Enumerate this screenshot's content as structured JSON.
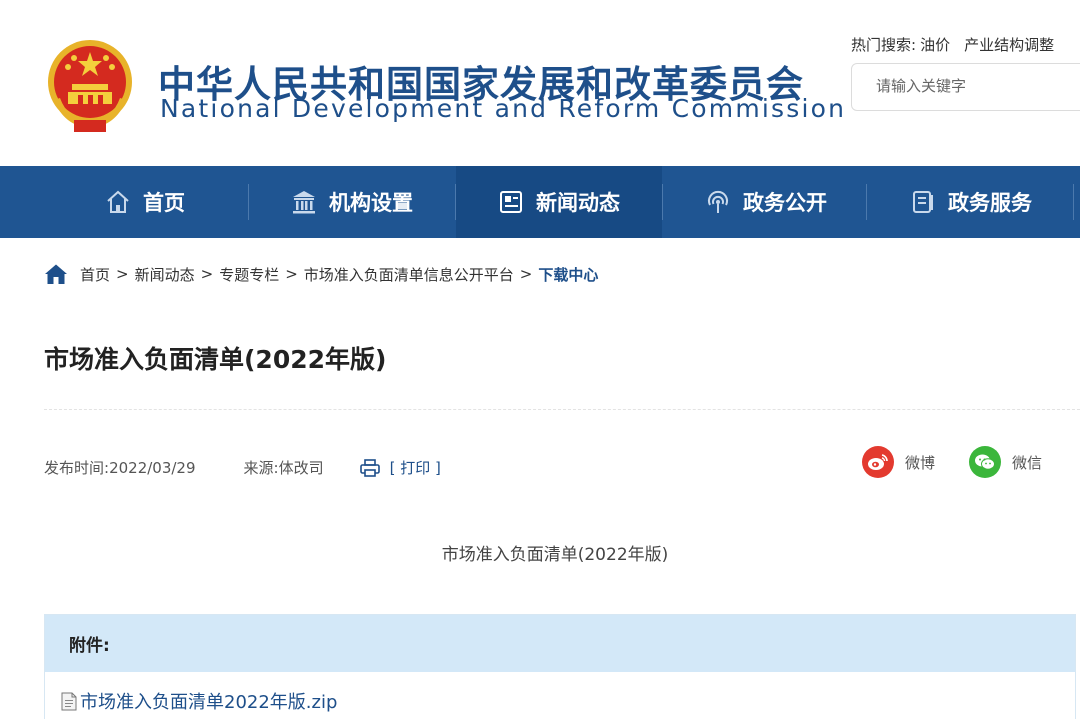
{
  "header": {
    "title_cn": "中华人民共和国国家发展和改革委员会",
    "title_en": "National Development and Reform Commission",
    "hot_search_label": "热门搜索:",
    "hot_search_items": [
      "油价",
      "产业结构调整"
    ],
    "search_placeholder": "请输入关键字"
  },
  "nav": {
    "items": [
      {
        "label": "首页",
        "icon": "home-icon"
      },
      {
        "label": "机构设置",
        "icon": "institution-icon"
      },
      {
        "label": "新闻动态",
        "icon": "news-icon",
        "active": true
      },
      {
        "label": "政务公开",
        "icon": "broadcast-icon"
      },
      {
        "label": "政务服务",
        "icon": "document-icon"
      }
    ],
    "color": "#1f5592",
    "active_color": "#174a84"
  },
  "breadcrumb": {
    "items": [
      "首页",
      "新闻动态",
      "专题专栏",
      "市场准入负面清单信息公开平台"
    ],
    "current": "下载中心",
    "separator": ">"
  },
  "article": {
    "title": "市场准入负面清单(2022年版)",
    "publish_label": "发布时间:",
    "publish_date": "2022/03/29",
    "source_label": "来源:",
    "source": "体改司",
    "print_label": "[ 打印 ]",
    "share_weibo": "微博",
    "share_wechat": "微信",
    "body_subtitle": "市场准入负面清单(2022年版)"
  },
  "attachments": {
    "header": "附件:",
    "files": [
      "市场准入负面清单2022年版.zip"
    ]
  }
}
